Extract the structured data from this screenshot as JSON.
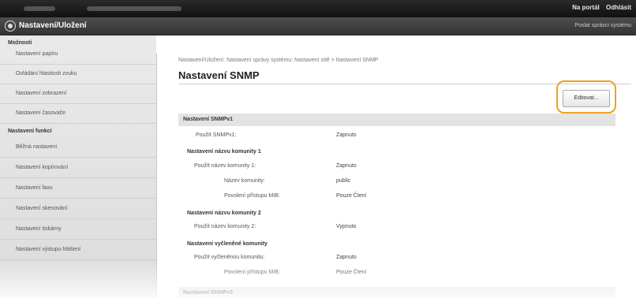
{
  "topbar": {
    "portal_link": "Na portál",
    "logout_link": "Odhlásit"
  },
  "titlebar": {
    "title": "Nastavení/Uložení",
    "right_link": "Poslat správci systému"
  },
  "sidebar": {
    "section1_title": "Možnosti",
    "section1_items": [
      "Nastavení papíru",
      "Ovládání hlasitosti zvuku",
      "Nastavení zobrazení",
      "Nastavení časovače"
    ],
    "section2_title": "Nastavení funkcí",
    "section2_items": [
      "Běžná nastavení",
      "Nastavení kopírování",
      "Nastavení faxu",
      "Nastavení skenování",
      "Nastavení tiskárny",
      "Nastavení výstupu hlášení"
    ]
  },
  "main": {
    "breadcrumb": "Nastavení/Uložení: Nastavení správy systému: Nastavení sítě > Nastavení SNMP",
    "page_title": "Nastavení SNMP",
    "edit_button": "Editovat..."
  },
  "snmpv1": {
    "header": "Nastavení SNMPv1",
    "use_label": "Použít SNMPv1:",
    "use_value": "Zapnuto",
    "community1_title": "Nastavení názvu komunity 1",
    "community1_use_label": "Použít název komunity 1:",
    "community1_use_value": "Zapnuto",
    "community_name_label": "Název komunity:",
    "community_name_value": "public",
    "mib_label": "Povolení přístupu MIB:",
    "mib_value": "Pouze Čtení",
    "community2_title": "Nastavení názvu komunity 2",
    "community2_use_label": "Použít název komunity 2:",
    "community2_use_value": "Vypnuto",
    "dedicated_title": "Nastavení vyčleněné komunity",
    "dedicated_use_label": "Použít vyčleněnou komunitu:",
    "dedicated_use_value": "Zapnuto",
    "dedicated_mib_label": "Povolení přístupu MIB:",
    "dedicated_mib_value": "Pouze Čtení"
  },
  "snmpv3": {
    "header": "Nastavení SNMPv3"
  },
  "colors": {
    "highlight": "#f0a21e",
    "topbar": "#111111",
    "section_header": "#e3e3e3"
  }
}
